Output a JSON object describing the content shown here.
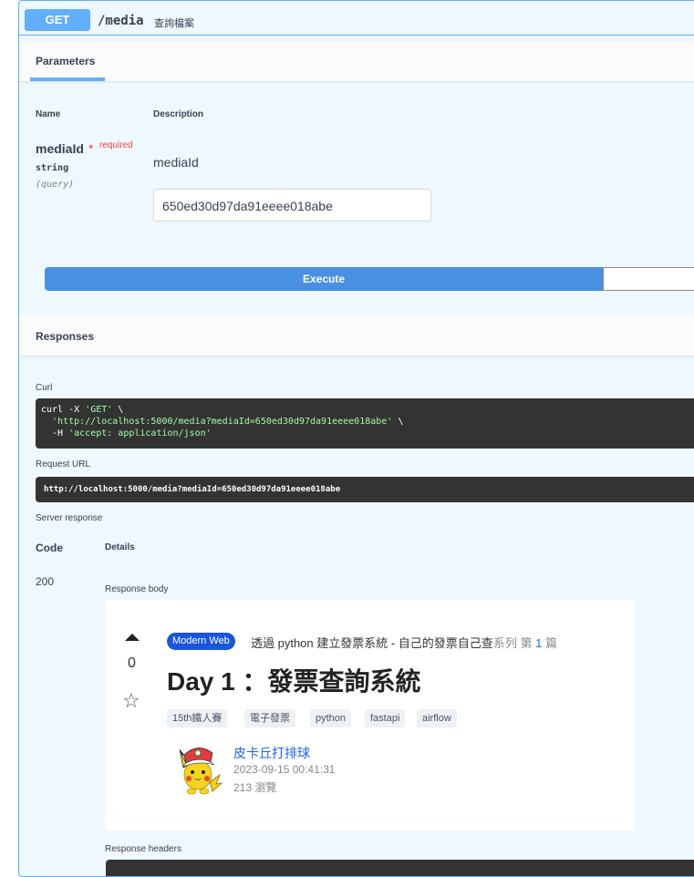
{
  "operation": {
    "method": "GET",
    "path": "/media",
    "summary": "查詢檔案"
  },
  "parameters": {
    "tab": "Parameters",
    "columns": {
      "name": "Name",
      "description": "Description"
    },
    "param": {
      "name": "mediaId",
      "required_star": "*",
      "required_label": "required",
      "type": "string",
      "in": "(query)",
      "description": "mediaId",
      "value": "650ed30d97da91eeee018abe"
    }
  },
  "execute_label": "Execute",
  "responses": {
    "title": "Responses",
    "curl_label": "Curl",
    "curl": {
      "line1_cmd": "curl -X ",
      "line1_str": "'GET'",
      "line1_tail": " \\",
      "line2_str": "  'http://localhost:5000/media?mediaId=650ed30d97da91eeee018abe'",
      "line2_tail": " \\",
      "line3_cmd": "  -H ",
      "line3_str": "'accept: application/json'"
    },
    "request_url_label": "Request URL",
    "request_url": "http://localhost:5000/media?mediaId=650ed30d97da91eeee018abe",
    "server_response_label": "Server response",
    "code_header": "Code",
    "details_header": "Details",
    "code": "200",
    "body_label": "Response body",
    "headers_label": "Response headers"
  },
  "article": {
    "vote_count": "0",
    "badge": "Modern Web",
    "series_prefix": "透過 python 建立發票系統 - 自己的發票自己查",
    "series_word": "系列",
    "series_index_prefix": "第",
    "series_index": "1",
    "series_index_suffix": "篇",
    "title": "Day 1 ：發票查詢系統",
    "tags": [
      "15th鐵人賽",
      "電子發票",
      "python",
      "fastapi",
      "airflow"
    ],
    "author": "皮卡丘打排球",
    "date": "2023-09-15 00:41:31",
    "views": "213 瀏覽"
  },
  "colors": {
    "get_blue": "#61affe",
    "execute_blue": "#4990e2",
    "required_red": "#f93e3e",
    "code_bg": "#333333",
    "string_green": "#a2fca2"
  }
}
